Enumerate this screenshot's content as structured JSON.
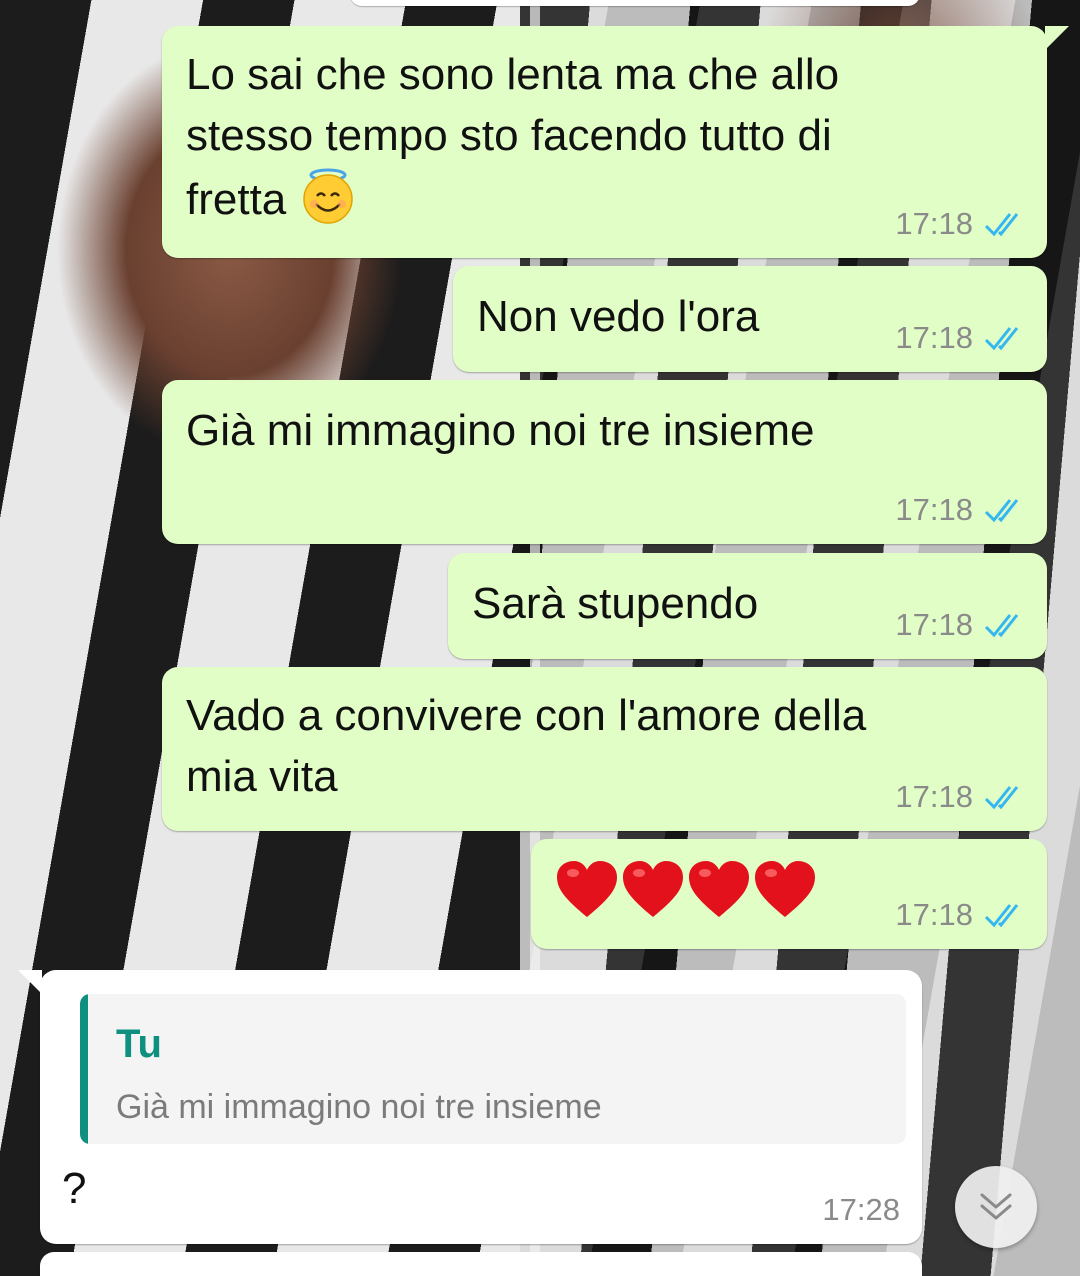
{
  "theme": {
    "outgoing_bubble": "#e1fec6",
    "incoming_bubble": "#ffffff",
    "quote_accent": "#0e8f80",
    "read_ticks": "#34b7f1"
  },
  "messages": [
    {
      "direction": "outgoing",
      "text_lines": [
        "Lo sai che sono lenta ma che allo",
        "stesso tempo sto facendo tutto di",
        "fretta"
      ],
      "trailing_emoji": "smiling-face-with-halo",
      "time": "17:18",
      "status": "read"
    },
    {
      "direction": "outgoing",
      "text": "Non vedo l'ora",
      "time": "17:18",
      "status": "read"
    },
    {
      "direction": "outgoing",
      "text": "Già mi immagino noi tre insieme",
      "time": "17:18",
      "status": "read"
    },
    {
      "direction": "outgoing",
      "text": "Sarà stupendo",
      "time": "17:18",
      "status": "read"
    },
    {
      "direction": "outgoing",
      "text_lines": [
        "Vado a convivere con l'amore della",
        "mia vita"
      ],
      "time": "17:18",
      "status": "read"
    },
    {
      "direction": "outgoing",
      "emoji": [
        "red-heart",
        "red-heart",
        "red-heart",
        "red-heart"
      ],
      "time": "17:18",
      "status": "read"
    },
    {
      "direction": "incoming",
      "quoted": {
        "author": "Tu",
        "text": "Già mi immagino noi tre insieme"
      },
      "text": "?",
      "time": "17:28"
    }
  ],
  "controls": {
    "scroll_to_bottom_icon": "double-chevron-down-icon"
  }
}
